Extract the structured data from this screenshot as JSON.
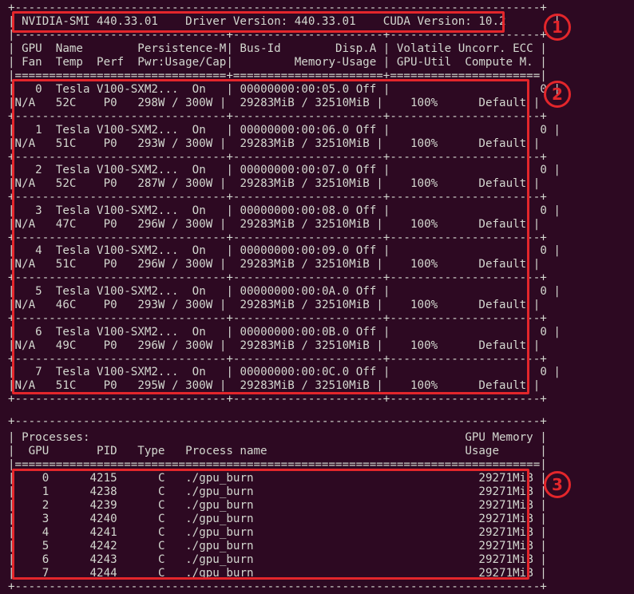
{
  "colors": {
    "background": "#2d0922",
    "text": "#d3d7cf",
    "highlight": "#e3262b"
  },
  "header": {
    "title": "NVIDIA-SMI 440.33.01    Driver Version: 440.33.01    CUDA Version: 10.2",
    "col_line1": "GPU  Name        Persistence-M| Bus-Id        Disp.A | Volatile Uncorr. ECC",
    "col_line2": "Fan  Temp  Perf  Pwr:Usage/Cap|         Memory-Usage | GPU-Util  Compute M."
  },
  "gpus": [
    {
      "id": "0",
      "name": "Tesla V100-SXM2...",
      "persist": "On",
      "bus": "00000000:00:05.0",
      "disp": "Off",
      "ecc": "0",
      "fan": "N/A",
      "temp": "52C",
      "perf": "P0",
      "pwr": "298W / 300W",
      "mem": "29283MiB / 32510MiB",
      "util": "100%",
      "compute": "Default"
    },
    {
      "id": "1",
      "name": "Tesla V100-SXM2...",
      "persist": "On",
      "bus": "00000000:00:06.0",
      "disp": "Off",
      "ecc": "0",
      "fan": "N/A",
      "temp": "51C",
      "perf": "P0",
      "pwr": "293W / 300W",
      "mem": "29283MiB / 32510MiB",
      "util": "100%",
      "compute": "Default"
    },
    {
      "id": "2",
      "name": "Tesla V100-SXM2...",
      "persist": "On",
      "bus": "00000000:00:07.0",
      "disp": "Off",
      "ecc": "0",
      "fan": "N/A",
      "temp": "52C",
      "perf": "P0",
      "pwr": "287W / 300W",
      "mem": "29283MiB / 32510MiB",
      "util": "100%",
      "compute": "Default"
    },
    {
      "id": "3",
      "name": "Tesla V100-SXM2...",
      "persist": "On",
      "bus": "00000000:00:08.0",
      "disp": "Off",
      "ecc": "0",
      "fan": "N/A",
      "temp": "47C",
      "perf": "P0",
      "pwr": "296W / 300W",
      "mem": "29283MiB / 32510MiB",
      "util": "100%",
      "compute": "Default"
    },
    {
      "id": "4",
      "name": "Tesla V100-SXM2...",
      "persist": "On",
      "bus": "00000000:00:09.0",
      "disp": "Off",
      "ecc": "0",
      "fan": "N/A",
      "temp": "51C",
      "perf": "P0",
      "pwr": "296W / 300W",
      "mem": "29283MiB / 32510MiB",
      "util": "100%",
      "compute": "Default"
    },
    {
      "id": "5",
      "name": "Tesla V100-SXM2...",
      "persist": "On",
      "bus": "00000000:00:0A.0",
      "disp": "Off",
      "ecc": "0",
      "fan": "N/A",
      "temp": "46C",
      "perf": "P0",
      "pwr": "293W / 300W",
      "mem": "29283MiB / 32510MiB",
      "util": "100%",
      "compute": "Default"
    },
    {
      "id": "6",
      "name": "Tesla V100-SXM2...",
      "persist": "On",
      "bus": "00000000:00:0B.0",
      "disp": "Off",
      "ecc": "0",
      "fan": "N/A",
      "temp": "49C",
      "perf": "P0",
      "pwr": "296W / 300W",
      "mem": "29283MiB / 32510MiB",
      "util": "100%",
      "compute": "Default"
    },
    {
      "id": "7",
      "name": "Tesla V100-SXM2...",
      "persist": "On",
      "bus": "00000000:00:0C.0",
      "disp": "Off",
      "ecc": "0",
      "fan": "N/A",
      "temp": "51C",
      "perf": "P0",
      "pwr": "295W / 300W",
      "mem": "29283MiB / 32510MiB",
      "util": "100%",
      "compute": "Default"
    }
  ],
  "processes": {
    "title": "Processes:",
    "gpu_memory_header": "GPU Memory",
    "header_gpu": "GPU",
    "header_pid": "PID",
    "header_type": "Type",
    "header_name": "Process name",
    "header_usage": "Usage",
    "rows": [
      {
        "gpu": "0",
        "pid": "4215",
        "type": "C",
        "name": "./gpu_burn",
        "mem": "29271MiB"
      },
      {
        "gpu": "1",
        "pid": "4238",
        "type": "C",
        "name": "./gpu_burn",
        "mem": "29271MiB"
      },
      {
        "gpu": "2",
        "pid": "4239",
        "type": "C",
        "name": "./gpu_burn",
        "mem": "29271MiB"
      },
      {
        "gpu": "3",
        "pid": "4240",
        "type": "C",
        "name": "./gpu_burn",
        "mem": "29271MiB"
      },
      {
        "gpu": "4",
        "pid": "4241",
        "type": "C",
        "name": "./gpu_burn",
        "mem": "29271MiB"
      },
      {
        "gpu": "5",
        "pid": "4242",
        "type": "C",
        "name": "./gpu_burn",
        "mem": "29271MiB"
      },
      {
        "gpu": "6",
        "pid": "4243",
        "type": "C",
        "name": "./gpu_burn",
        "mem": "29271MiB"
      },
      {
        "gpu": "7",
        "pid": "4244",
        "type": "C",
        "name": "./gpu_burn",
        "mem": "29271MiB"
      }
    ]
  },
  "annotations": [
    "1",
    "2",
    "3"
  ]
}
